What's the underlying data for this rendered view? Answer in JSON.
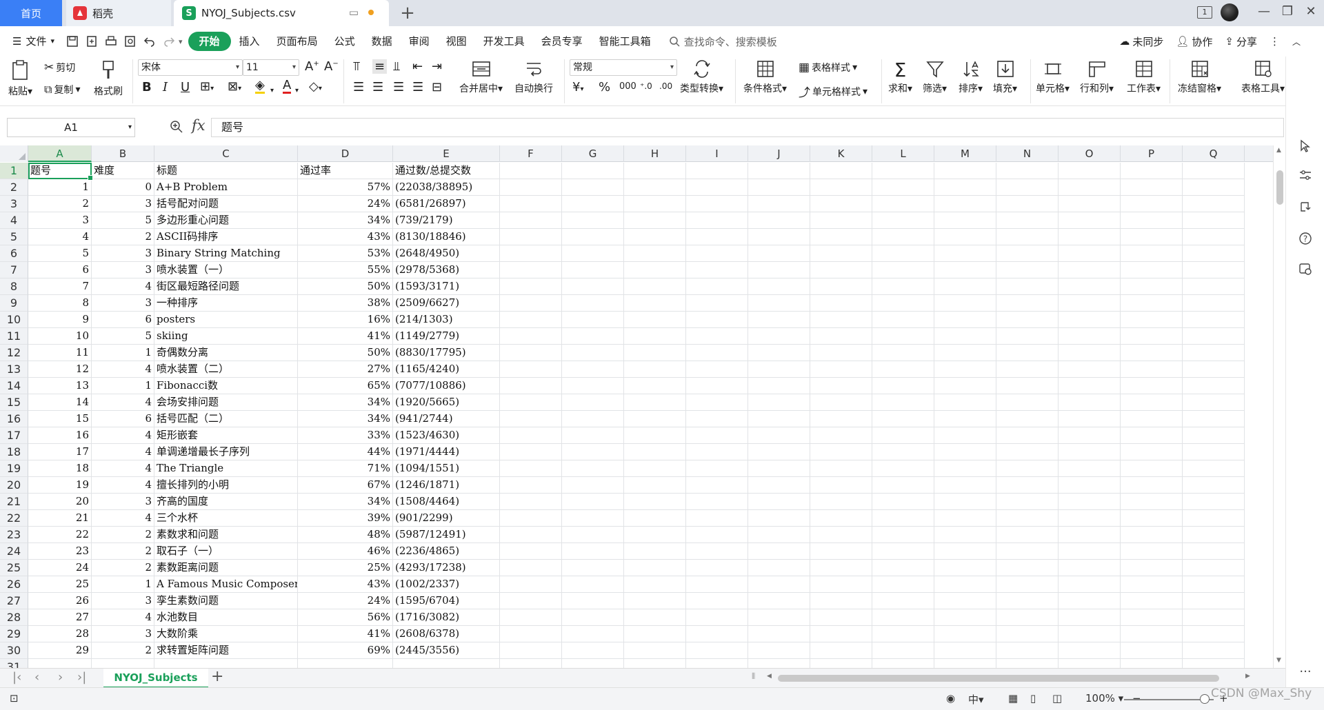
{
  "titlebar": {
    "tabs": [
      {
        "label": "首页"
      },
      {
        "label": "稻壳"
      },
      {
        "label": "NYOJ_Subjects.csv"
      }
    ],
    "badge": "1"
  },
  "menu": {
    "file": "文件",
    "items": [
      "开始",
      "插入",
      "页面布局",
      "公式",
      "数据",
      "审阅",
      "视图",
      "开发工具",
      "会员专享",
      "智能工具箱"
    ],
    "search": "查找命令、搜索模板",
    "sync": "未同步",
    "collab": "协作",
    "share": "分享"
  },
  "ribbon": {
    "paste": "粘贴",
    "cut": "剪切",
    "copy": "复制",
    "format_painter": "格式刷",
    "font_name": "宋体",
    "font_size": "11",
    "merge": "合并居中",
    "wrap": "自动换行",
    "number_format": "常规",
    "type_convert": "类型转换",
    "cond_format": "条件格式",
    "table_style": "表格样式",
    "cell_style": "单元格样式",
    "sum": "求和",
    "filter": "筛选",
    "sort": "排序",
    "fill": "填充",
    "cell": "单元格",
    "row_col": "行和列",
    "worksheet": "工作表",
    "freeze": "冻结窗格",
    "table_tools": "表格工具"
  },
  "formula": {
    "name_box": "A1",
    "fx": "fx",
    "value": "题号"
  },
  "columns": [
    "A",
    "B",
    "C",
    "D",
    "E",
    "F",
    "G",
    "H",
    "I",
    "J",
    "K",
    "L",
    "M",
    "N",
    "O",
    "P",
    "Q"
  ],
  "table": {
    "header": [
      "题号",
      "难度",
      "标题",
      "通过率",
      "通过数/总提交数"
    ],
    "rows": [
      [
        "1",
        "0",
        "A+B Problem",
        "57%",
        "(22038/38895)"
      ],
      [
        "2",
        "3",
        "括号配对问题",
        "24%",
        "(6581/26897)"
      ],
      [
        "3",
        "5",
        "多边形重心问题",
        "34%",
        "(739/2179)"
      ],
      [
        "4",
        "2",
        "ASCII码排序",
        "43%",
        "(8130/18846)"
      ],
      [
        "5",
        "3",
        "Binary String Matching",
        "53%",
        "(2648/4950)"
      ],
      [
        "6",
        "3",
        "喷水装置（一）",
        "55%",
        "(2978/5368)"
      ],
      [
        "7",
        "4",
        "街区最短路径问题",
        "50%",
        "(1593/3171)"
      ],
      [
        "8",
        "3",
        "一种排序",
        "38%",
        "(2509/6627)"
      ],
      [
        "9",
        "6",
        "posters",
        "16%",
        "(214/1303)"
      ],
      [
        "10",
        "5",
        "skiing",
        "41%",
        "(1149/2779)"
      ],
      [
        "11",
        "1",
        "奇偶数分离",
        "50%",
        "(8830/17795)"
      ],
      [
        "12",
        "4",
        "喷水装置（二）",
        "27%",
        "(1165/4240)"
      ],
      [
        "13",
        "1",
        "Fibonacci数",
        "65%",
        "(7077/10886)"
      ],
      [
        "14",
        "4",
        "会场安排问题",
        "34%",
        "(1920/5665)"
      ],
      [
        "15",
        "6",
        "括号匹配（二）",
        "34%",
        "(941/2744)"
      ],
      [
        "16",
        "4",
        "矩形嵌套",
        "33%",
        "(1523/4630)"
      ],
      [
        "17",
        "4",
        "单调递增最长子序列",
        "44%",
        "(1971/4444)"
      ],
      [
        "18",
        "4",
        "The Triangle",
        "71%",
        "(1094/1551)"
      ],
      [
        "19",
        "4",
        "擅长排列的小明",
        "67%",
        "(1246/1871)"
      ],
      [
        "20",
        "3",
        "齐高的国度",
        "34%",
        "(1508/4464)"
      ],
      [
        "21",
        "4",
        "三个水杯",
        "39%",
        "(901/2299)"
      ],
      [
        "22",
        "2",
        "素数求和问题",
        "48%",
        "(5987/12491)"
      ],
      [
        "23",
        "2",
        "取石子（一）",
        "46%",
        "(2236/4865)"
      ],
      [
        "24",
        "2",
        "素数距离问题",
        "25%",
        "(4293/17238)"
      ],
      [
        "25",
        "1",
        "A Famous Music Composer",
        "43%",
        "(1002/2337)"
      ],
      [
        "26",
        "3",
        "孪生素数问题",
        "24%",
        "(1595/6704)"
      ],
      [
        "27",
        "4",
        "水池数目",
        "56%",
        "(1716/3082)"
      ],
      [
        "28",
        "3",
        "大数阶乘",
        "41%",
        "(2608/6378)"
      ],
      [
        "29",
        "2",
        "求转置矩阵问题",
        "69%",
        "(2445/3556)"
      ]
    ]
  },
  "sheet": {
    "tab": "NYOJ_Subjects"
  },
  "status": {
    "zoom": "100%"
  },
  "watermark": "CSDN @Max_Shy",
  "colors": {
    "accent": "#1aa05a",
    "home_tab": "#3a7ff6",
    "daoke_logo": "#e5343a"
  }
}
